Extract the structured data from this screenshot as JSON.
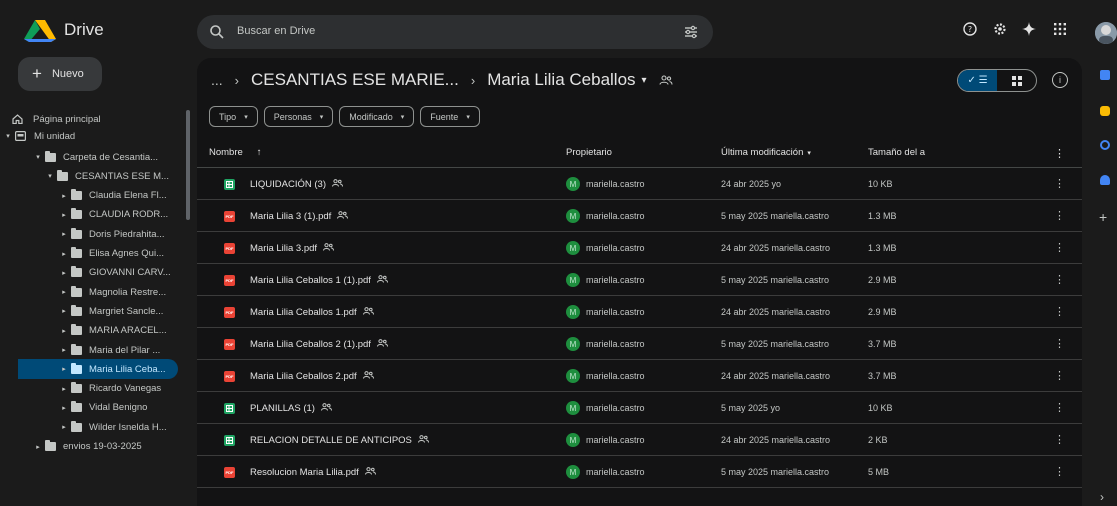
{
  "app": {
    "title": "Drive"
  },
  "search": {
    "placeholder": "Buscar en Drive"
  },
  "new_button": {
    "label": "Nuevo"
  },
  "sidebar": {
    "home": "Página principal",
    "my_unit": "Mi unidad",
    "tree": [
      {
        "label": "Carpeta de Cesantia...",
        "level": 1,
        "active": false
      },
      {
        "label": "CESANTIAS ESE M...",
        "level": 2,
        "active": false
      },
      {
        "label": "Claudia Elena Fl...",
        "level": 3,
        "active": false
      },
      {
        "label": "CLAUDIA RODR...",
        "level": 3,
        "active": false
      },
      {
        "label": "Doris Piedrahita...",
        "level": 3,
        "active": false
      },
      {
        "label": "Elisa Agnes Qui...",
        "level": 3,
        "active": false
      },
      {
        "label": "GIOVANNI CARV...",
        "level": 3,
        "active": false
      },
      {
        "label": "Magnolia Restre...",
        "level": 3,
        "active": false
      },
      {
        "label": "Margriet Sancle...",
        "level": 3,
        "active": false
      },
      {
        "label": "MARIA ARACEL...",
        "level": 3,
        "active": false
      },
      {
        "label": "Maria del Pilar ...",
        "level": 3,
        "active": false
      },
      {
        "label": "Maria Lilia Ceba...",
        "level": 3,
        "active": true
      },
      {
        "label": "Ricardo Vanegas",
        "level": 3,
        "active": false
      },
      {
        "label": "Vidal Benigno",
        "level": 3,
        "active": false
      },
      {
        "label": "Wilder Isnelda H...",
        "level": 3,
        "active": false
      },
      {
        "label": "envios 19-03-2025",
        "level": 1,
        "active": false
      }
    ]
  },
  "breadcrumb": {
    "ellipsis": "...",
    "parent": "CESANTIAS ESE MARIE...",
    "current": "Maria Lilia Ceballos"
  },
  "filters": [
    "Tipo",
    "Personas",
    "Modificado",
    "Fuente"
  ],
  "table": {
    "headers": {
      "name": "Nombre",
      "owner": "Propietario",
      "modified": "Última modificación",
      "size": "Tamaño del a"
    },
    "rows": [
      {
        "type": "sheet",
        "name": "LIQUIDACIÓN (3)",
        "owner": "mariella.castro",
        "modified": "24 abr 2025 yo",
        "size": "10 KB"
      },
      {
        "type": "pdf",
        "name": "Maria Lilia 3 (1).pdf",
        "owner": "mariella.castro",
        "modified": "5 may 2025 mariella.castro",
        "size": "1.3 MB"
      },
      {
        "type": "pdf",
        "name": "Maria Lilia 3.pdf",
        "owner": "mariella.castro",
        "modified": "24 abr 2025 mariella.castro",
        "size": "1.3 MB"
      },
      {
        "type": "pdf",
        "name": "Maria Lilia Ceballos 1 (1).pdf",
        "owner": "mariella.castro",
        "modified": "5 may 2025 mariella.castro",
        "size": "2.9 MB"
      },
      {
        "type": "pdf",
        "name": "Maria Lilia Ceballos 1.pdf",
        "owner": "mariella.castro",
        "modified": "24 abr 2025 mariella.castro",
        "size": "2.9 MB"
      },
      {
        "type": "pdf",
        "name": "Maria Lilia Ceballos 2 (1).pdf",
        "owner": "mariella.castro",
        "modified": "5 may 2025 mariella.castro",
        "size": "3.7 MB"
      },
      {
        "type": "pdf",
        "name": "Maria Lilia Ceballos 2.pdf",
        "owner": "mariella.castro",
        "modified": "24 abr 2025 mariella.castro",
        "size": "3.7 MB"
      },
      {
        "type": "sheet",
        "name": "PLANILLAS (1)",
        "owner": "mariella.castro",
        "modified": "5 may 2025 yo",
        "size": "10 KB"
      },
      {
        "type": "sheet",
        "name": "RELACION DETALLE DE ANTICIPOS",
        "owner": "mariella.castro",
        "modified": "24 abr 2025 mariella.castro",
        "size": "2 KB"
      },
      {
        "type": "pdf",
        "name": "Resolucion Maria Lilia.pdf",
        "owner": "mariella.castro",
        "modified": "5 may 2025 mariella.castro",
        "size": "5 MB"
      }
    ]
  },
  "owner_avatar_letter": "M",
  "colors": {
    "accent": "#004a77",
    "accent_text": "#c2e7ff",
    "sheet": "#1fa463",
    "pdf": "#ea4335"
  }
}
